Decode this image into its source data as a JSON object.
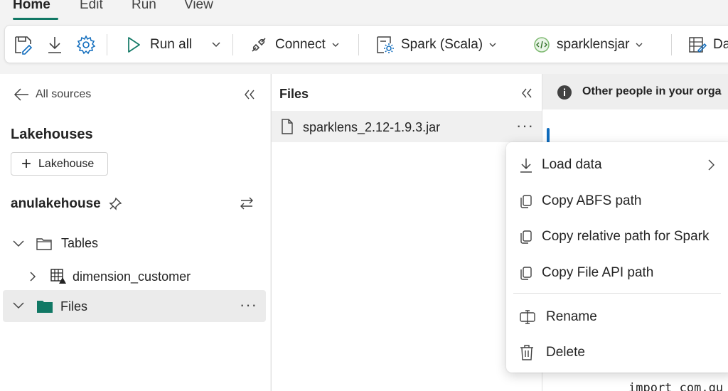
{
  "menu": {
    "tabs": [
      {
        "label": "Home"
      },
      {
        "label": "Edit"
      },
      {
        "label": "Run"
      },
      {
        "label": "View"
      }
    ]
  },
  "toolbar": {
    "run_all": "Run all",
    "connect": "Connect",
    "language": "Spark (Scala)",
    "environment": "sparklensjar",
    "data_wrangler": "Da"
  },
  "explorer": {
    "back_label": "All sources",
    "section_title": "Lakehouses",
    "add_lakehouse": "Lakehouse",
    "lakehouse_name": "anulakehouse",
    "tables_label": "Tables",
    "table_item": "dimension_customer",
    "files_label": "Files"
  },
  "files_panel": {
    "title": "Files",
    "file_name": "sparklens_2.12-1.9.3.jar"
  },
  "banner": {
    "text": "Other people in your orga"
  },
  "context_menu": {
    "items": [
      {
        "label": "Load data"
      },
      {
        "label": "Copy ABFS path"
      },
      {
        "label": "Copy relative path for Spark"
      },
      {
        "label": "Copy File API path"
      },
      {
        "label": "Rename"
      },
      {
        "label": "Delete"
      }
    ]
  },
  "code": {
    "line": "import com.qu"
  },
  "colors": {
    "accent": "#117865",
    "folder": "#117865",
    "cursor": "#0f6cbd"
  }
}
